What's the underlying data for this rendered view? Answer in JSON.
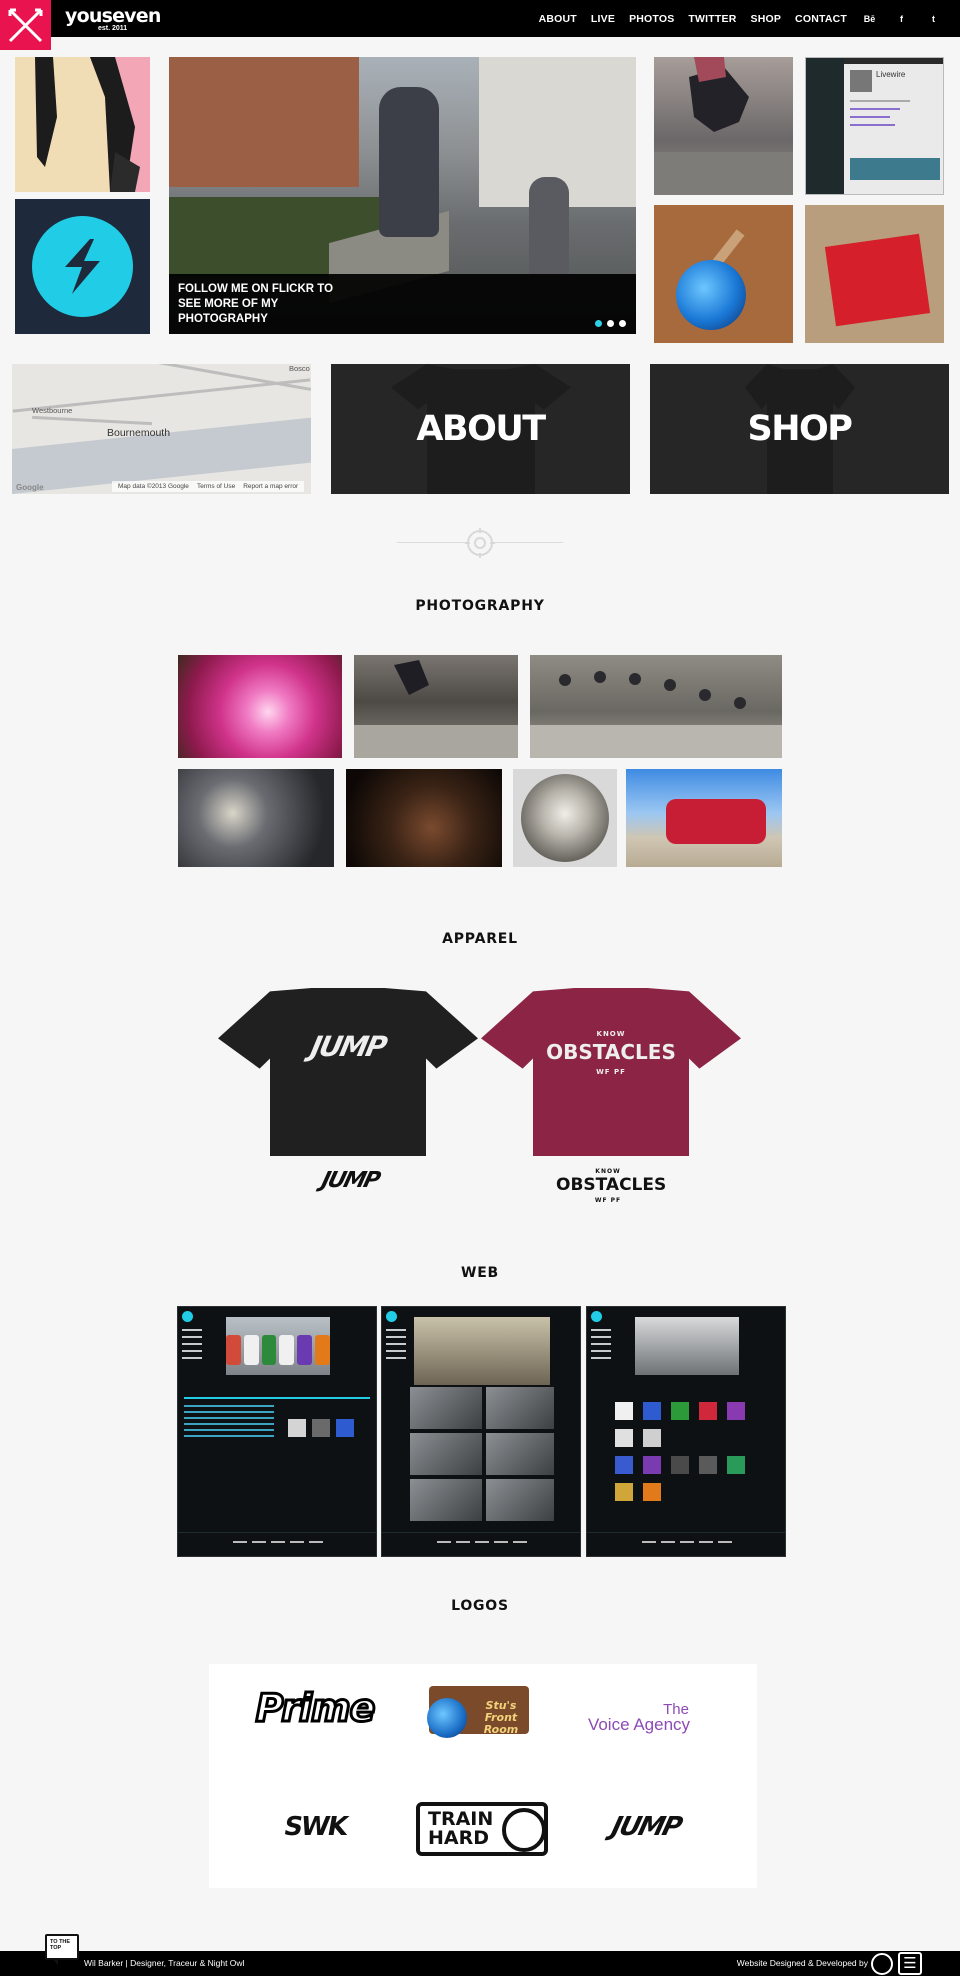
{
  "header": {
    "brand": "youseven",
    "brand_sub": "est. 2011",
    "nav": [
      "ABOUT",
      "LIVE",
      "PHOTOS",
      "TWITTER",
      "SHOP",
      "CONTACT"
    ],
    "social": [
      {
        "icon": "behance-icon",
        "glyph": "Bē"
      },
      {
        "icon": "facebook-icon",
        "glyph": "f"
      },
      {
        "icon": "tumblr-icon",
        "glyph": "t"
      }
    ],
    "accent_color": "#e8134f"
  },
  "hero": {
    "caption": "FOLLOW ME ON FLICKR TO SEE MORE OF MY PHOTOGRAPHY",
    "slides_count": 3,
    "active_slide": 1,
    "accent_color": "#2ed2e8",
    "twitter_name": "Livewire"
  },
  "map": {
    "city": "Bournemouth",
    "town_west": "Westbourne",
    "town_east": "Bosco",
    "google": "Google",
    "attribution": [
      "Map data ©2013 Google",
      "Terms of Use",
      "Report a map error"
    ]
  },
  "promos": {
    "about": "ABOUT",
    "shop": "SHOP"
  },
  "sections": {
    "photography": "PHOTOGRAPHY",
    "apparel": "APPAREL",
    "web": "WEB",
    "logos": "LOGOS"
  },
  "apparel": {
    "jump_print": "JUMP",
    "obstacles_top": "KNOW",
    "obstacles_print": "OBSTACLES",
    "obstacles_bottom": "WF  PF"
  },
  "logos": {
    "prime": "Prime",
    "stu_line1": "Stu's",
    "stu_line2": "Front Room",
    "voice_the": "The",
    "voice_agency": "Voice Agency",
    "star": "SWK",
    "train_line1": "TRAIN",
    "train_line2": "HARD",
    "jump": "JUMP"
  },
  "footer": {
    "to_top": "TO THE TOP",
    "left": "Wil Barker | Designer, Traceur & Night Owl",
    "right": "Website Designed & Developed by"
  }
}
